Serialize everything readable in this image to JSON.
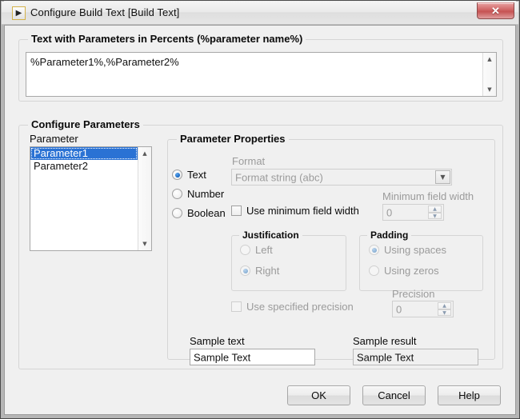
{
  "window": {
    "title": "Configure Build Text [Build Text]",
    "icon": "labview-vi-icon",
    "close_label": "✕"
  },
  "text_group": {
    "title": "Text with Parameters in Percents (%parameter name%)",
    "textarea_value": "%Parameter1%,%Parameter2%",
    "scroll_up": "▲",
    "scroll_down": "▼"
  },
  "configure_group": {
    "title": "Configure Parameters",
    "parameter_label": "Parameter",
    "parameters": [
      {
        "label": "Parameter1",
        "selected": true
      },
      {
        "label": "Parameter2",
        "selected": false
      }
    ],
    "scroll_up": "▲",
    "scroll_down": "▼"
  },
  "properties_group": {
    "title": "Parameter Properties",
    "type_radios": [
      {
        "label": "Text",
        "checked": true,
        "disabled": false
      },
      {
        "label": "Number",
        "checked": false,
        "disabled": false
      },
      {
        "label": "Boolean",
        "checked": false,
        "disabled": false
      }
    ],
    "format_label": "Format",
    "format_value": "Format string  (abc)",
    "format_dropdown_arrow": "▼",
    "min_width_checkbox": "Use minimum field width",
    "min_width_label": "Minimum field width",
    "min_width_value": "0",
    "spin_up": "▲",
    "spin_down": "▼",
    "justification": {
      "title": "Justification",
      "options": [
        {
          "label": "Left",
          "checked": false,
          "disabled": true
        },
        {
          "label": "Right",
          "checked": true,
          "disabled": true
        }
      ]
    },
    "padding": {
      "title": "Padding",
      "options": [
        {
          "label": "Using spaces",
          "checked": true,
          "disabled": true
        },
        {
          "label": "Using zeros",
          "checked": false,
          "disabled": true
        }
      ]
    },
    "precision_checkbox": "Use specified precision",
    "precision_label": "Precision",
    "precision_value": "0",
    "sample_text_label": "Sample text",
    "sample_text_value": "Sample Text",
    "sample_result_label": "Sample result",
    "sample_result_value": "Sample Text"
  },
  "footer": {
    "ok_label": "OK",
    "cancel_label": "Cancel",
    "help_label": "Help"
  },
  "colors": {
    "selection_blue": "#2a72d4",
    "dialog_bg": "#f0f0f0",
    "close_red": "#c65353",
    "disabled_text": "#9b9b9b"
  }
}
